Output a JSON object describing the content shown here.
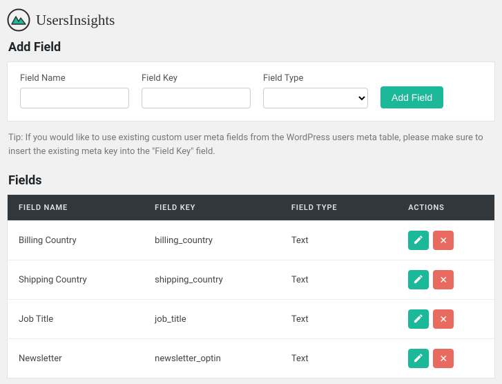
{
  "brand": {
    "name": "UsersInsights"
  },
  "add_field": {
    "title": "Add Field",
    "labels": {
      "name": "Field Name",
      "key": "Field Key",
      "type": "Field Type"
    },
    "button": "Add Field",
    "tip": "Tip: If you would like to use existing custom user meta fields from the WordPress users meta table, please make sure to insert the existing meta key into the \"Field Key\" field."
  },
  "fields_section": {
    "title": "Fields",
    "columns": {
      "name": "FIELD NAME",
      "key": "FIELD KEY",
      "type": "FIELD TYPE",
      "actions": "ACTIONS"
    },
    "rows": [
      {
        "name": "Billing Country",
        "key": "billing_country",
        "type": "Text"
      },
      {
        "name": "Shipping Country",
        "key": "shipping_country",
        "type": "Text"
      },
      {
        "name": "Job Title",
        "key": "job_title",
        "type": "Text"
      },
      {
        "name": "Newsletter",
        "key": "newsletter_optin",
        "type": "Text"
      }
    ]
  }
}
